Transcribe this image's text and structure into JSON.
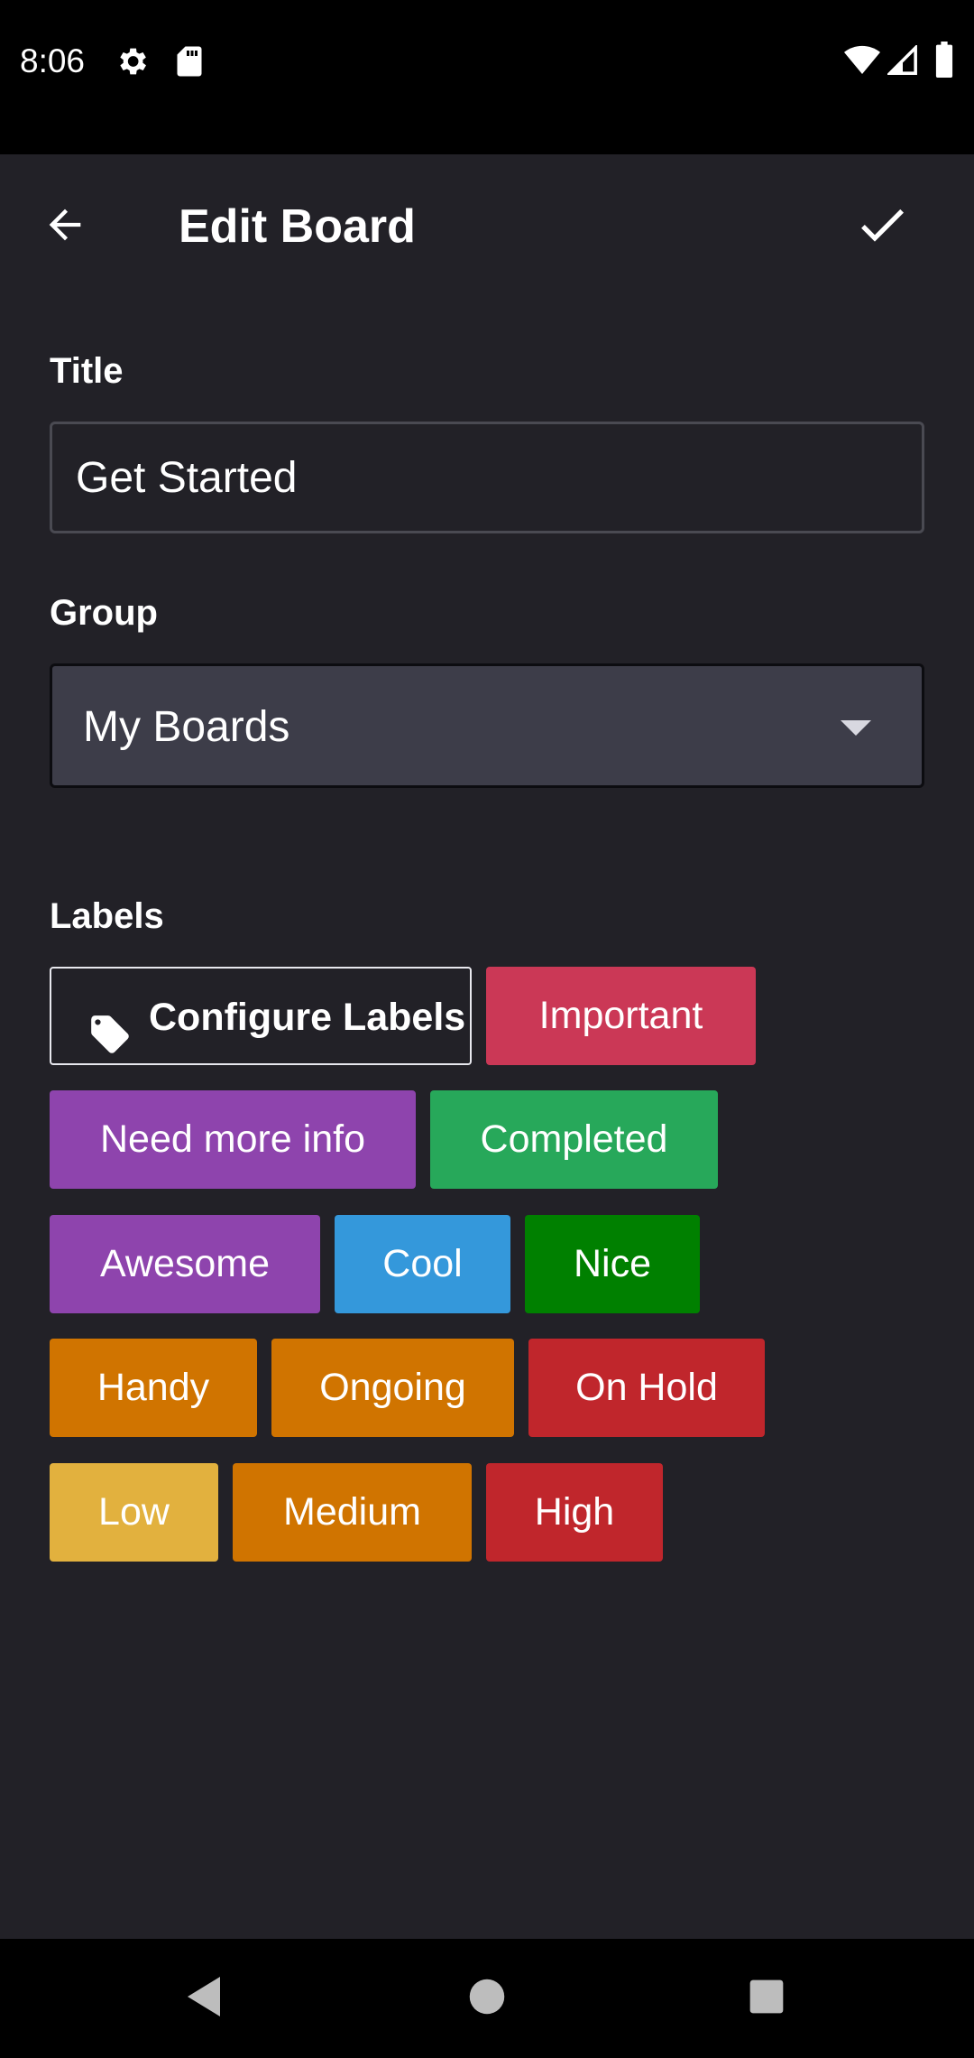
{
  "status_bar": {
    "time": "8:06",
    "left_icons": [
      "gear-icon",
      "sd-card-icon"
    ],
    "right_icons": [
      "wifi-icon",
      "signal-icon",
      "battery-icon"
    ]
  },
  "toolbar": {
    "title": "Edit Board",
    "back_icon": "arrow-back-icon",
    "save_icon": "check-icon"
  },
  "form": {
    "title_label": "Title",
    "title_value": "Get Started",
    "group_label": "Group",
    "group_value": "My Boards",
    "labels_label": "Labels"
  },
  "labels": {
    "configure": "Configure Labels",
    "items": [
      {
        "text": "Important",
        "color": "#cb3856"
      },
      {
        "text": "Need more info",
        "color": "#8e44ad"
      },
      {
        "text": "Completed",
        "color": "#27a85a"
      },
      {
        "text": "Awesome",
        "color": "#8e44ad"
      },
      {
        "text": "Cool",
        "color": "#3498db"
      },
      {
        "text": "Nice",
        "color": "#008000"
      },
      {
        "text": "Handy",
        "color": "#d07400"
      },
      {
        "text": "Ongoing",
        "color": "#d07400"
      },
      {
        "text": "On Hold",
        "color": "#c0262c"
      },
      {
        "text": "Low",
        "color": "#e2b13e"
      },
      {
        "text": "Medium",
        "color": "#d07400"
      },
      {
        "text": "High",
        "color": "#c0262c"
      }
    ]
  },
  "nav_bar": {
    "icons": [
      "back-triangle-icon",
      "home-circle-icon",
      "recents-square-icon"
    ]
  }
}
